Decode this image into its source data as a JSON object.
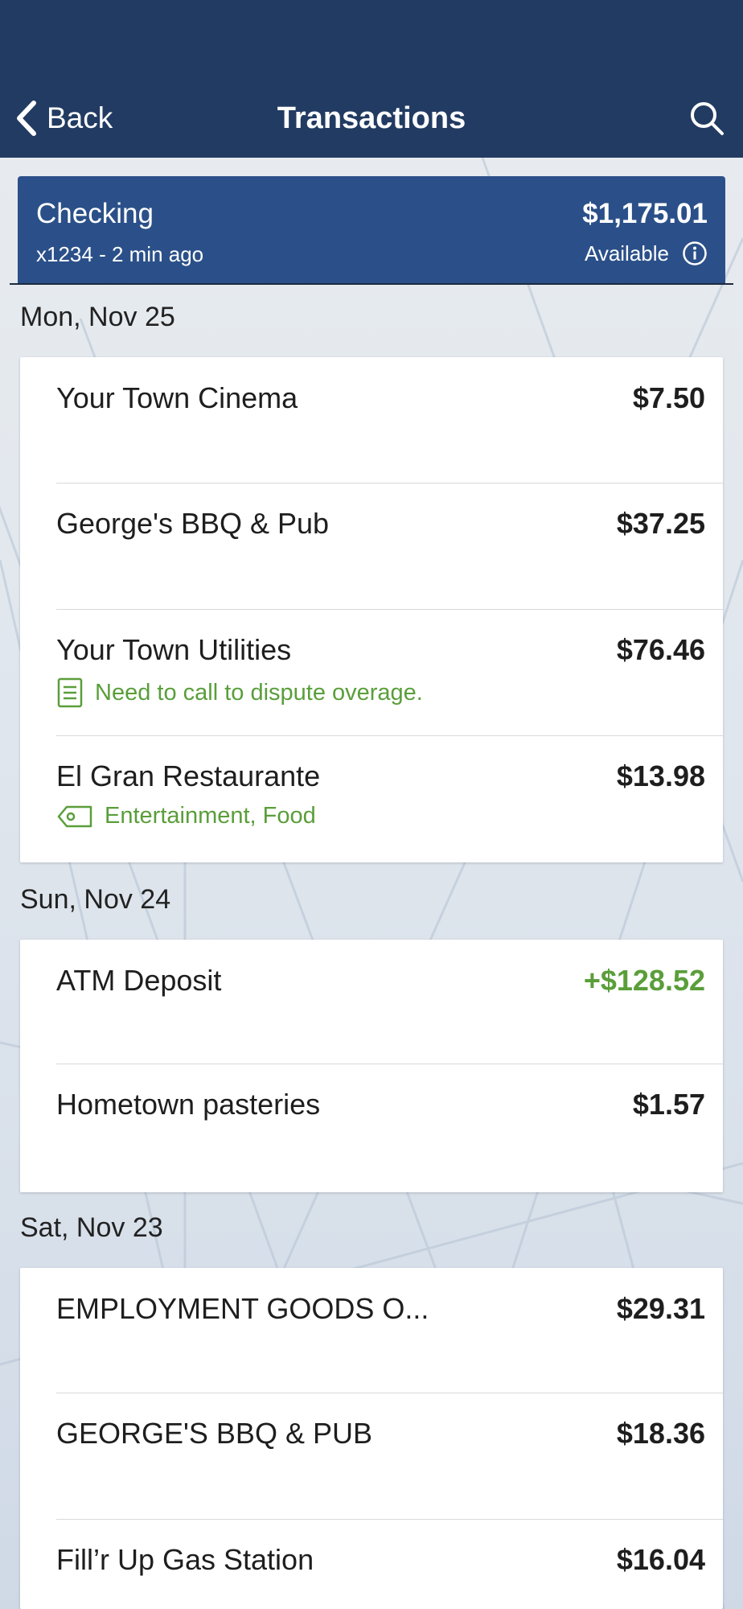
{
  "header": {
    "back_label": "Back",
    "title": "Transactions",
    "bar_color": "#223b62"
  },
  "account": {
    "name": "Checking",
    "subtitle": "x1234 - 2 min ago",
    "balance": "$1,175.01",
    "balance_label": "Available",
    "card_color": "#2b5089"
  },
  "colors": {
    "credit": "#5a9e3a",
    "note": "#5a9e3a"
  },
  "groups": [
    {
      "date": "Mon, Nov 25",
      "transactions": [
        {
          "merchant": "Your Town Cinema",
          "amount": "$7.50"
        },
        {
          "merchant": "George's BBQ & Pub",
          "amount": "$37.25"
        },
        {
          "merchant": "Your Town Utilities",
          "amount": "$76.46",
          "note": "Need to call to dispute overage.",
          "note_icon": "note-icon"
        },
        {
          "merchant": "El Gran Restaurante",
          "amount": "$13.98",
          "tags": "Entertainment, Food",
          "tag_icon": "tag-icon"
        }
      ]
    },
    {
      "date": "Sun, Nov 24",
      "transactions": [
        {
          "merchant": "ATM Deposit",
          "amount": "+$128.52",
          "type": "credit"
        },
        {
          "merchant": "Hometown pasteries",
          "amount": "$1.57"
        }
      ]
    },
    {
      "date": "Sat, Nov 23",
      "transactions": [
        {
          "merchant": "EMPLOYMENT GOODS O...",
          "amount": "$29.31"
        },
        {
          "merchant": "GEORGE'S BBQ & PUB",
          "amount": "$18.36"
        },
        {
          "merchant": "Fill’r Up Gas Station",
          "amount": "$16.04"
        }
      ]
    }
  ]
}
